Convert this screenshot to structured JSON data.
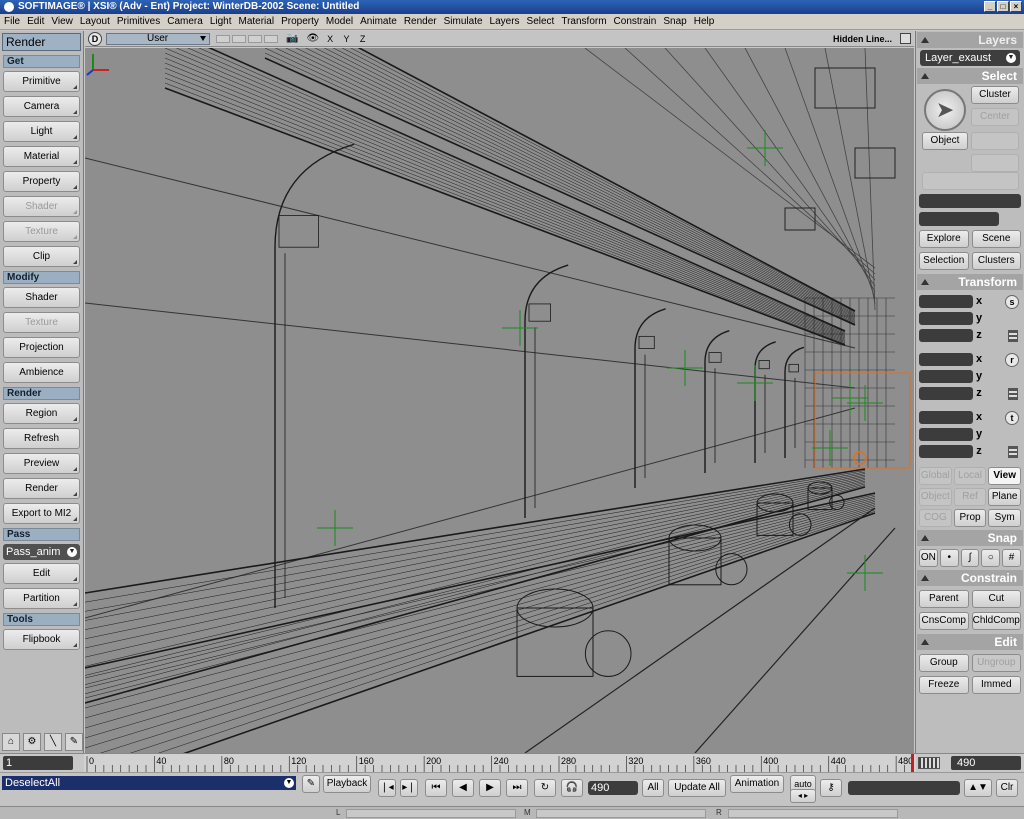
{
  "window": {
    "title": "SOFTIMAGE® | XSI® (Adv - Ent) Project: WinterDB-2002    Scene: Untitled",
    "buttons": [
      "_",
      "□",
      "×"
    ]
  },
  "menu": [
    "File",
    "Edit",
    "View",
    "Layout",
    "Primitives",
    "Camera",
    "Light",
    "Material",
    "Property",
    "Model",
    "Animate",
    "Render",
    "Simulate",
    "Layers",
    "Select",
    "Transform",
    "Constrain",
    "Snap",
    "Help"
  ],
  "left_panel": {
    "title": "Render",
    "get_label": "Get",
    "get_buttons": [
      "Primitive",
      "Camera",
      "Light",
      "Material",
      "Property",
      "Shader",
      "Texture",
      "Clip"
    ],
    "modify_label": "Modify",
    "modify_buttons": [
      "Shader",
      "Texture",
      "Projection",
      "Ambience"
    ],
    "render_label": "Render",
    "render_buttons": [
      "Region",
      "Refresh",
      "Preview",
      "Render",
      "Export to MI2"
    ],
    "pass_label": "Pass",
    "pass_value": "Pass_anim",
    "pass_buttons": [
      "Edit",
      "Partition"
    ],
    "tools_label": "Tools",
    "tools_buttons": [
      "Flipbook"
    ]
  },
  "viewport": {
    "letter": "D",
    "camera": "User",
    "axes": "X Y Z",
    "display_mode": "Hidden Line..."
  },
  "right_panel": {
    "layers_title": "Layers",
    "layer_value": "Layer_exaust",
    "select_title": "Select",
    "select_buttons": {
      "cluster": "Cluster",
      "center": "Center",
      "object": "Object"
    },
    "explore": "Explore",
    "scene": "Scene",
    "selection": "Selection",
    "clusters": "Clusters",
    "transform_title": "Transform",
    "axis_labels": [
      "x",
      "y",
      "z"
    ],
    "transform_modes": [
      "s",
      "r",
      "t"
    ],
    "ref_row1": [
      "Global",
      "Local",
      "View"
    ],
    "ref_row2": [
      "Object",
      "Ref",
      "Plane"
    ],
    "ref_row3": [
      "COG",
      "Prop",
      "Sym"
    ],
    "snap_title": "Snap",
    "snap_on": "ON",
    "constrain_title": "Constrain",
    "constrain_buttons": [
      "Parent",
      "Cut",
      "CnsComp",
      "ChldComp"
    ],
    "edit_title": "Edit",
    "edit_buttons": [
      "Group",
      "Ungroup",
      "Freeze",
      "Immed"
    ]
  },
  "timeline": {
    "start": "1",
    "end": "490",
    "ticks": [
      "0",
      "40",
      "80",
      "120",
      "160",
      "200",
      "240",
      "280",
      "320",
      "360",
      "400",
      "440",
      "480"
    ]
  },
  "bottom": {
    "script": "DeselectAll",
    "playback": "Playback",
    "frame": "490",
    "all": "All",
    "update_all": "Update All",
    "animation": "Animation",
    "auto": "auto",
    "clr": "Clr",
    "mouse_left": "L",
    "mouse_middle": "M",
    "mouse_right": "R"
  },
  "colors": {
    "viewport_bg": "#8e8e8e",
    "wire": "#1a1a1a",
    "selection_orange": "#e07020",
    "null_green": "#1c8a1c"
  }
}
